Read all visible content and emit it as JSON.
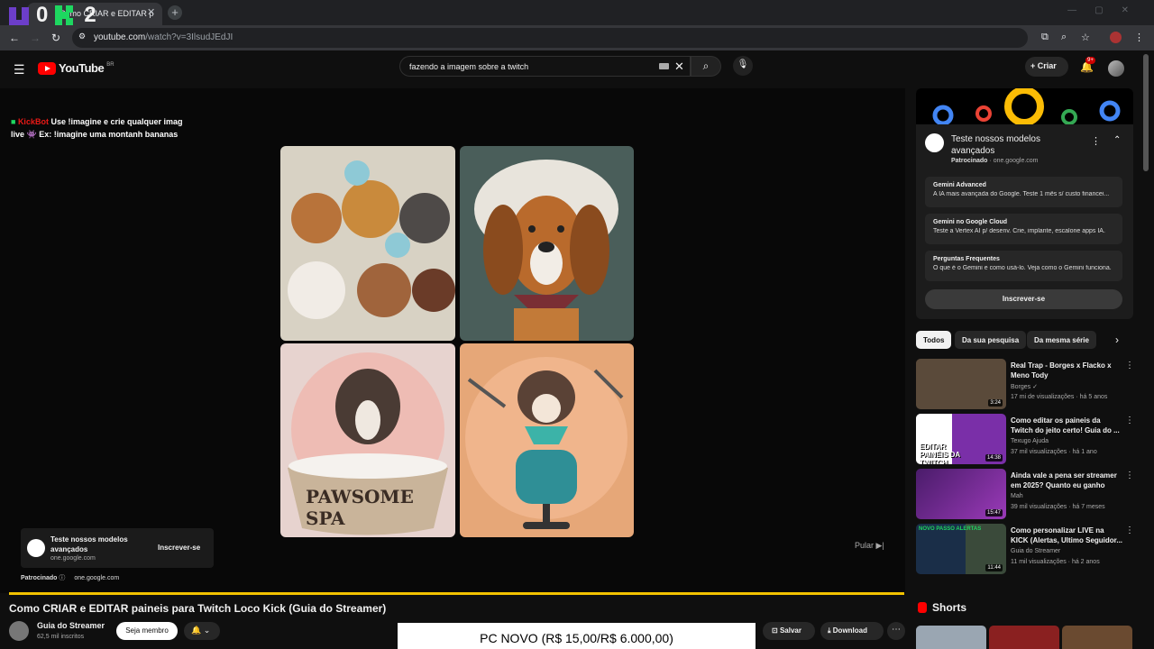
{
  "browser": {
    "tab_title": "Como CRIAR e EDITAR p",
    "url_domain": "youtube.com",
    "url_path": "/watch?v=3IlsudJEdJI"
  },
  "overlay": {
    "left_digit": "0",
    "right_digit": "2"
  },
  "header": {
    "logo_text": "YouTube",
    "country_code": "BR",
    "search_query": "fazendo a imagem sobre a twitch",
    "create_label": "Criar",
    "notification_count": "9+"
  },
  "player": {
    "chat": {
      "user": "KickBot",
      "message": "Use !imagine e crie qualquer imag live 👾 Ex: !imagine uma montanh bananas"
    },
    "tiles": [
      {
        "name": "tile-dogs-group",
        "text": ""
      },
      {
        "name": "tile-dog-portrait",
        "text": ""
      },
      {
        "name": "tile-dog-bath",
        "text": "PAWSOME SPA"
      },
      {
        "name": "tile-dog-barber",
        "text": ""
      }
    ],
    "skip_label": "Pular",
    "ad_card": {
      "title": "Teste nossos modelos avançados",
      "domain": "one.google.com",
      "cta": "Inscrever-se"
    },
    "sponsor_label": "Patrocinado",
    "sponsor_domain": "one.google.com"
  },
  "video": {
    "title": "Como CRIAR e EDITAR paineis para Twitch Loco Kick (Guia do Streamer)",
    "channel": "Guia do Streamer",
    "subscribers": "62,5 mil inscritos",
    "member_label": "Seja membro",
    "save_label": "Salvar",
    "download_label": "Download"
  },
  "banner_text": "PC NOVO (R$ 15,00/R$ 6.000,00)",
  "side_ad": {
    "title": "Teste nossos modelos avançados",
    "sponsored": "Patrocinado",
    "domain": "one.google.com",
    "items": [
      {
        "heading": "Gemini Advanced",
        "sub": "A IA mais avançada do Google. Teste 1 mês s/ custo financei..."
      },
      {
        "heading": "Gemini no Google Cloud",
        "sub": "Teste a Vertex AI p/ desenv. Crie, implante, escalone apps IA."
      },
      {
        "heading": "Perguntas Frequentes",
        "sub": "O que é o Gemini e como usá-lo. Veja como o Gemini funciona."
      }
    ],
    "cta": "Inscrever-se"
  },
  "chips": [
    "Todos",
    "Da sua pesquisa",
    "Da mesma série"
  ],
  "related": [
    {
      "title": "Real Trap - Borges x Flacko x Meno Tody",
      "channel": "Borges",
      "meta": "17 mi de visualizações · há 5 anos",
      "duration": "3:24",
      "thumb": "#5a4a3a"
    },
    {
      "title": "Como editar os paineis da Twitch do jeito certo! Guia do ...",
      "channel": "Texugo Ajuda",
      "meta": "37 mil visualizações · há 1 ano",
      "duration": "14:38",
      "thumb": "#7a2fa8",
      "thumb_text": "EDITAR PAINÉIS DA TWITCH"
    },
    {
      "title": "Ainda vale a pena ser streamer em 2025? Quanto eu ganho",
      "channel": "Mah",
      "meta": "39 mil visualizações · há 7 meses",
      "duration": "15:47",
      "thumb": "#6a2a8a"
    },
    {
      "title": "Como personalizar LIVE na KICK (Alertas, Ultimo Seguidor...",
      "channel": "Guia do Streamer",
      "meta": "11 mil visualizações · há 2 anos",
      "duration": "11:44",
      "thumb": "#1f3a2a",
      "thumb_text": "NOVO PASSO ALERTAS"
    }
  ],
  "shorts_label": "Shorts"
}
